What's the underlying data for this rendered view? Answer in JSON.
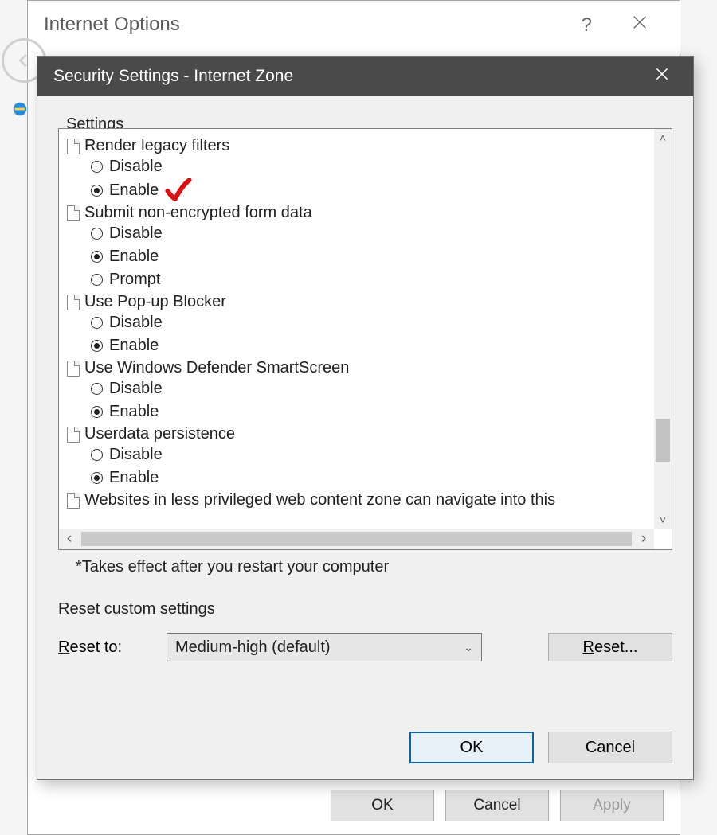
{
  "parent": {
    "title": "Internet Options",
    "help_glyph": "?",
    "buttons": {
      "ok": "OK",
      "cancel": "Cancel",
      "apply": "Apply"
    }
  },
  "dialog": {
    "title": "Security Settings - Internet Zone",
    "settings_label": "Settings",
    "note": "*Takes effect after you restart your computer",
    "reset_group_label": "Reset custom settings",
    "reset_to_label": "Reset to:",
    "reset_to_value": "Medium-high (default)",
    "reset_button": "Reset...",
    "ok": "OK",
    "cancel": "Cancel"
  },
  "settings": [
    {
      "name": "Render legacy filters",
      "options": [
        {
          "label": "Disable",
          "selected": false
        },
        {
          "label": "Enable",
          "selected": true,
          "annotated": true
        }
      ]
    },
    {
      "name": "Submit non-encrypted form data",
      "options": [
        {
          "label": "Disable",
          "selected": false
        },
        {
          "label": "Enable",
          "selected": true
        },
        {
          "label": "Prompt",
          "selected": false
        }
      ]
    },
    {
      "name": "Use Pop-up Blocker",
      "options": [
        {
          "label": "Disable",
          "selected": false
        },
        {
          "label": "Enable",
          "selected": true
        }
      ]
    },
    {
      "name": "Use Windows Defender SmartScreen",
      "options": [
        {
          "label": "Disable",
          "selected": false
        },
        {
          "label": "Enable",
          "selected": true
        }
      ]
    },
    {
      "name": "Userdata persistence",
      "options": [
        {
          "label": "Disable",
          "selected": false
        },
        {
          "label": "Enable",
          "selected": true
        }
      ]
    },
    {
      "name": "Websites in less privileged web content zone can navigate into this",
      "options": []
    }
  ]
}
